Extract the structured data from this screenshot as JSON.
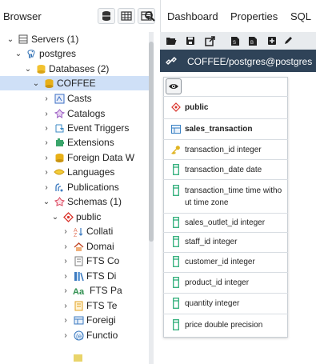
{
  "browser": {
    "title": "Browser"
  },
  "tabs": [
    {
      "label": "Dashboard"
    },
    {
      "label": "Properties"
    },
    {
      "label": "SQL"
    }
  ],
  "tree": {
    "servers": "Servers (1)",
    "server": "postgres",
    "databases": "Databases (2)",
    "database": "COFFEE",
    "items": [
      "Casts",
      "Catalogs",
      "Event Triggers",
      "Extensions",
      "Foreign Data W",
      "Languages",
      "Publications"
    ],
    "schemas": "Schemas (1)",
    "schema": "public",
    "schema_items": [
      "Collati",
      "Domai",
      "FTS Co",
      "FTS Di",
      "FTS Pa",
      "FTS Te",
      "Foreigi",
      "Functio"
    ]
  },
  "query_bar": {
    "text": "COFFEE/postgres@postgres"
  },
  "erd": {
    "schema": "public",
    "table": "sales_transaction",
    "columns": [
      "transaction_id integer",
      "transaction_date date",
      "transaction_time time without time zone",
      "sales_outlet_id integer",
      "staff_id integer",
      "customer_id integer",
      "product_id integer",
      "quantity integer",
      "price double precision"
    ]
  },
  "colors": {
    "selection": "#cfe0f7",
    "query_bar": "#2f4358",
    "toolbar": "#e8ebee",
    "schema_icon": "#d9342b",
    "table_icon": "#3b82c4",
    "column_icon": "#2fae7a",
    "key_icon": "#e0b422"
  }
}
